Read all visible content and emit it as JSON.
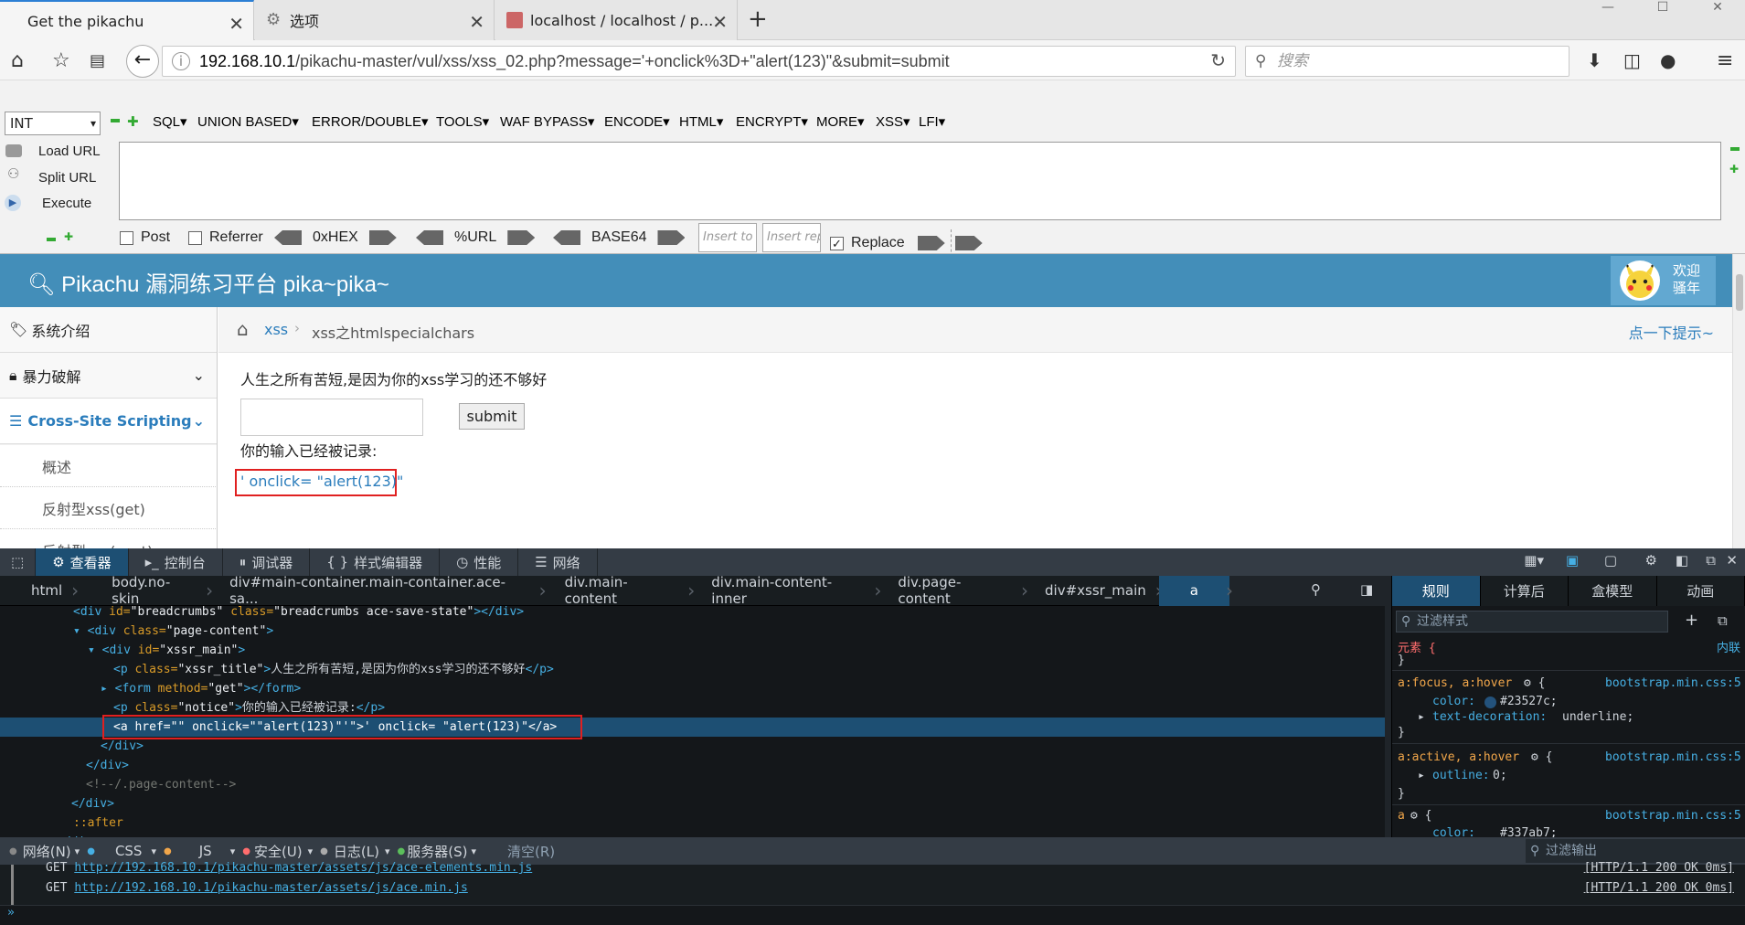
{
  "tabs": [
    {
      "title": "Get the pikachu",
      "active": true
    },
    {
      "title": "选项",
      "active": false
    },
    {
      "title": "localhost / localhost / p...",
      "active": false
    }
  ],
  "nav": {
    "url_host": "192.168.10.1",
    "url_path": "/pikachu-master/vul/xss/xss_02.php?message='+onclick%3D+\"alert(123)\"&submit=submit",
    "search_placeholder": "搜索"
  },
  "hackbar": {
    "select_value": "INT",
    "menus": [
      "SQL▾",
      "UNION BASED▾",
      "ERROR/DOUBLE▾",
      "TOOLS▾",
      "WAF BYPASS▾",
      "ENCODE▾",
      "HTML▾",
      "ENCRYPT▾",
      "MORE▾",
      "XSS▾",
      "LFI▾"
    ],
    "load": "Load URL",
    "split": "Split URL",
    "execute": "Execute",
    "post": "Post",
    "referrer": "Referrer",
    "hex": "0xHEX",
    "urlenc": "%URL",
    "base64": "BASE64",
    "insert1": "Insert to r",
    "insert2": "Insert rep",
    "replace": "Replace"
  },
  "site": {
    "title": "Pikachu 漏洞练习平台 pika~pika~",
    "welcome1": "欢迎",
    "welcome2": "骚年",
    "sidebar": [
      "系统介绍",
      "暴力破解",
      "Cross-Site Scripting"
    ],
    "subitems": [
      "概述",
      "反射型xss(get)",
      "反射型xss(post)"
    ],
    "breadcrumb_home": "xss",
    "breadcrumb_current": "xss之htmlspecialchars",
    "hint": "点一下提示~",
    "intro": "人生之所有苦短,是因为你的xss学习的还不够好",
    "submit": "submit",
    "notice": "你的输入已经被记录:",
    "link_text": "' onclick= \"alert(123)\""
  },
  "devtools": {
    "tabs": [
      "查看器",
      "控制台",
      "调试器",
      "样式编辑器",
      "性能",
      "网络"
    ],
    "crumbs": [
      "html",
      "body.no-skin",
      "div#main-container.main-container.ace-sa...",
      "div.main-content",
      "div.main-content-inner",
      "div.page-content",
      "div#xssr_main",
      "a"
    ],
    "rule_tabs": [
      "规则",
      "计算后",
      "盒模型",
      "动画"
    ],
    "filter_styles": "过滤样式",
    "element_label": "元素 {",
    "inline": "内联",
    "r1_sel": "a:focus, a:hover",
    "r1_src": "bootstrap.min.css:5",
    "r1_p1": "color:",
    "r1_v1": "#23527c;",
    "r1_p2": "text-decoration:",
    "r1_v2": "underline;",
    "r2_sel": "a:active, a:hover",
    "r2_src": "bootstrap.min.css:5",
    "r2_p1": "outline:",
    "r2_v1": "0;",
    "r3_sel": "a",
    "r3_src": "bootstrap.min.css:5",
    "r3_p1": "color:",
    "r3_v1": "#337ab7;",
    "console_filters": [
      "网络(N)",
      "CSS",
      "JS",
      "安全(U)",
      "日志(L)",
      "服务器(S)",
      "清空(R)"
    ],
    "filter_output": "过滤输出",
    "log1_url": "http://192.168.10.1/pikachu-master/assets/js/ace-elements.min.js",
    "log2_url": "http://192.168.10.1/pikachu-master/assets/js/ace.min.js",
    "log_status": "[HTTP/1.1 200 OK 0ms]",
    "get": "GET"
  },
  "colors": {
    "accent": "#438eb9",
    "devtools_bg": "#14171a",
    "highlight": "#1d4f73",
    "annotation": "#e02020"
  }
}
